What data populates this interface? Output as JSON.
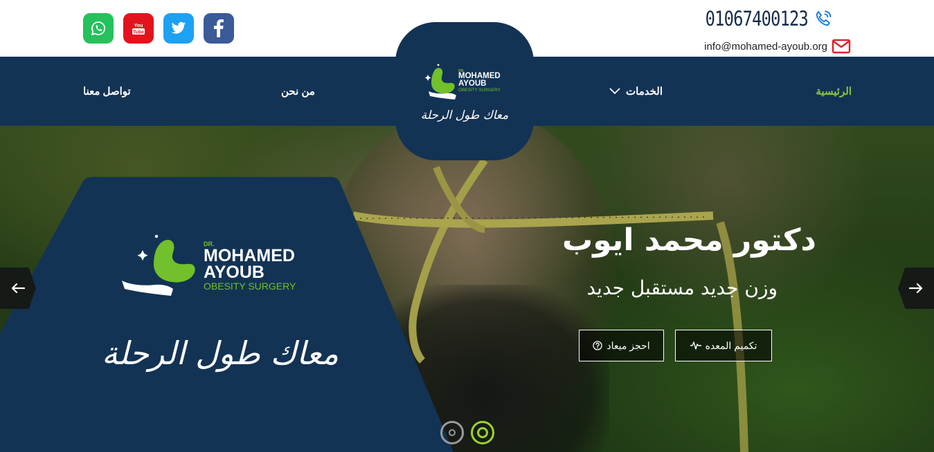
{
  "colors": {
    "navy": "#133355",
    "accent_green": "#8dc63f",
    "whatsapp": "#25c15c",
    "youtube": "#e3131c",
    "twitter": "#1da1f2",
    "facebook": "#3b5a98"
  },
  "header": {
    "social": [
      {
        "name": "whatsapp",
        "icon": "whatsapp-icon"
      },
      {
        "name": "youtube",
        "icon": "youtube-icon",
        "text": "You Tube"
      },
      {
        "name": "twitter",
        "icon": "twitter-icon"
      },
      {
        "name": "facebook",
        "icon": "facebook-icon"
      }
    ],
    "phone": "01067400123",
    "email": "info@mohamed-ayoub.org"
  },
  "nav": {
    "home": "الرئيسية",
    "services": "الخدمات",
    "about": "من نحن",
    "contact": "تواصل معنا"
  },
  "logo": {
    "dr": "DR.",
    "line1": "MOHAMED",
    "line2": "AYOUB",
    "line3": "OBESITY SURGERY",
    "slogan": "معاك طول الرحلة"
  },
  "hero": {
    "title": "دكتور محمد ايوب",
    "subtitle": "وزن جديد مستقبل جديد",
    "buttons": {
      "sleeve": "تكميم المعده",
      "book": "احجز ميعاد"
    },
    "slides": 2,
    "active_slide": 2
  }
}
